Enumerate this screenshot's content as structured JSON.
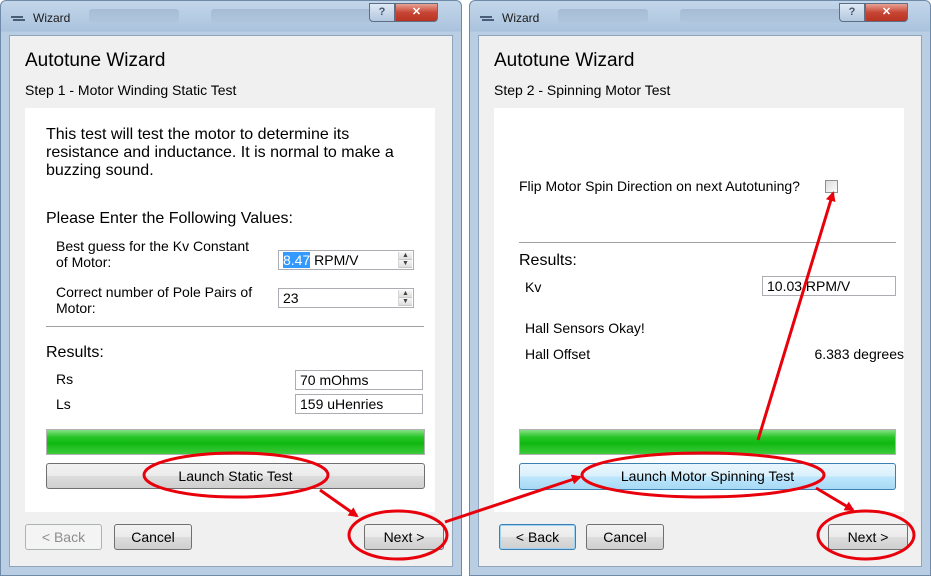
{
  "window_left": {
    "titlebar_title": "Wizard",
    "wizard_title": "Autotune Wizard",
    "step_title": "Step 1 - Motor Winding Static Test",
    "description": "This test will test the motor to determine its resistance and inductance. It is normal to make a buzzing sound.",
    "prompt": "Please Enter the Following Values:",
    "kv_label": "Best guess for the Kv Constant of Motor:",
    "kv_value": "8.47",
    "kv_unit": "RPM/V",
    "pole_pairs_label": "Correct number of Pole Pairs of Motor:",
    "pole_pairs_value": "23",
    "results_label": "Results:",
    "rs_label": "Rs",
    "rs_value": "70 mOhms",
    "ls_label": "Ls",
    "ls_value": "159 uHenries",
    "progress": 1.0,
    "launch_button": "Launch Static Test",
    "back_button": "< Back",
    "cancel_button": "Cancel",
    "next_button": "Next >"
  },
  "window_right": {
    "titlebar_title": "Wizard",
    "wizard_title": "Autotune Wizard",
    "step_title": "Step 2 - Spinning Motor Test",
    "flip_label": "Flip Motor Spin Direction on next Autotuning?",
    "flip_checked": false,
    "results_label": "Results:",
    "kv_label": "Kv",
    "kv_value": "10.03 RPM/V",
    "hall_status": "Hall Sensors Okay!",
    "hall_offset_label": "Hall Offset",
    "hall_offset_value": "6.383 degrees",
    "progress": 1.0,
    "launch_button": "Launch Motor Spinning Test",
    "back_button": "< Back",
    "cancel_button": "Cancel",
    "next_button": "Next >"
  },
  "annotation_colors": {
    "highlight": "#e8000b",
    "progress_green": "#1dc01d"
  }
}
